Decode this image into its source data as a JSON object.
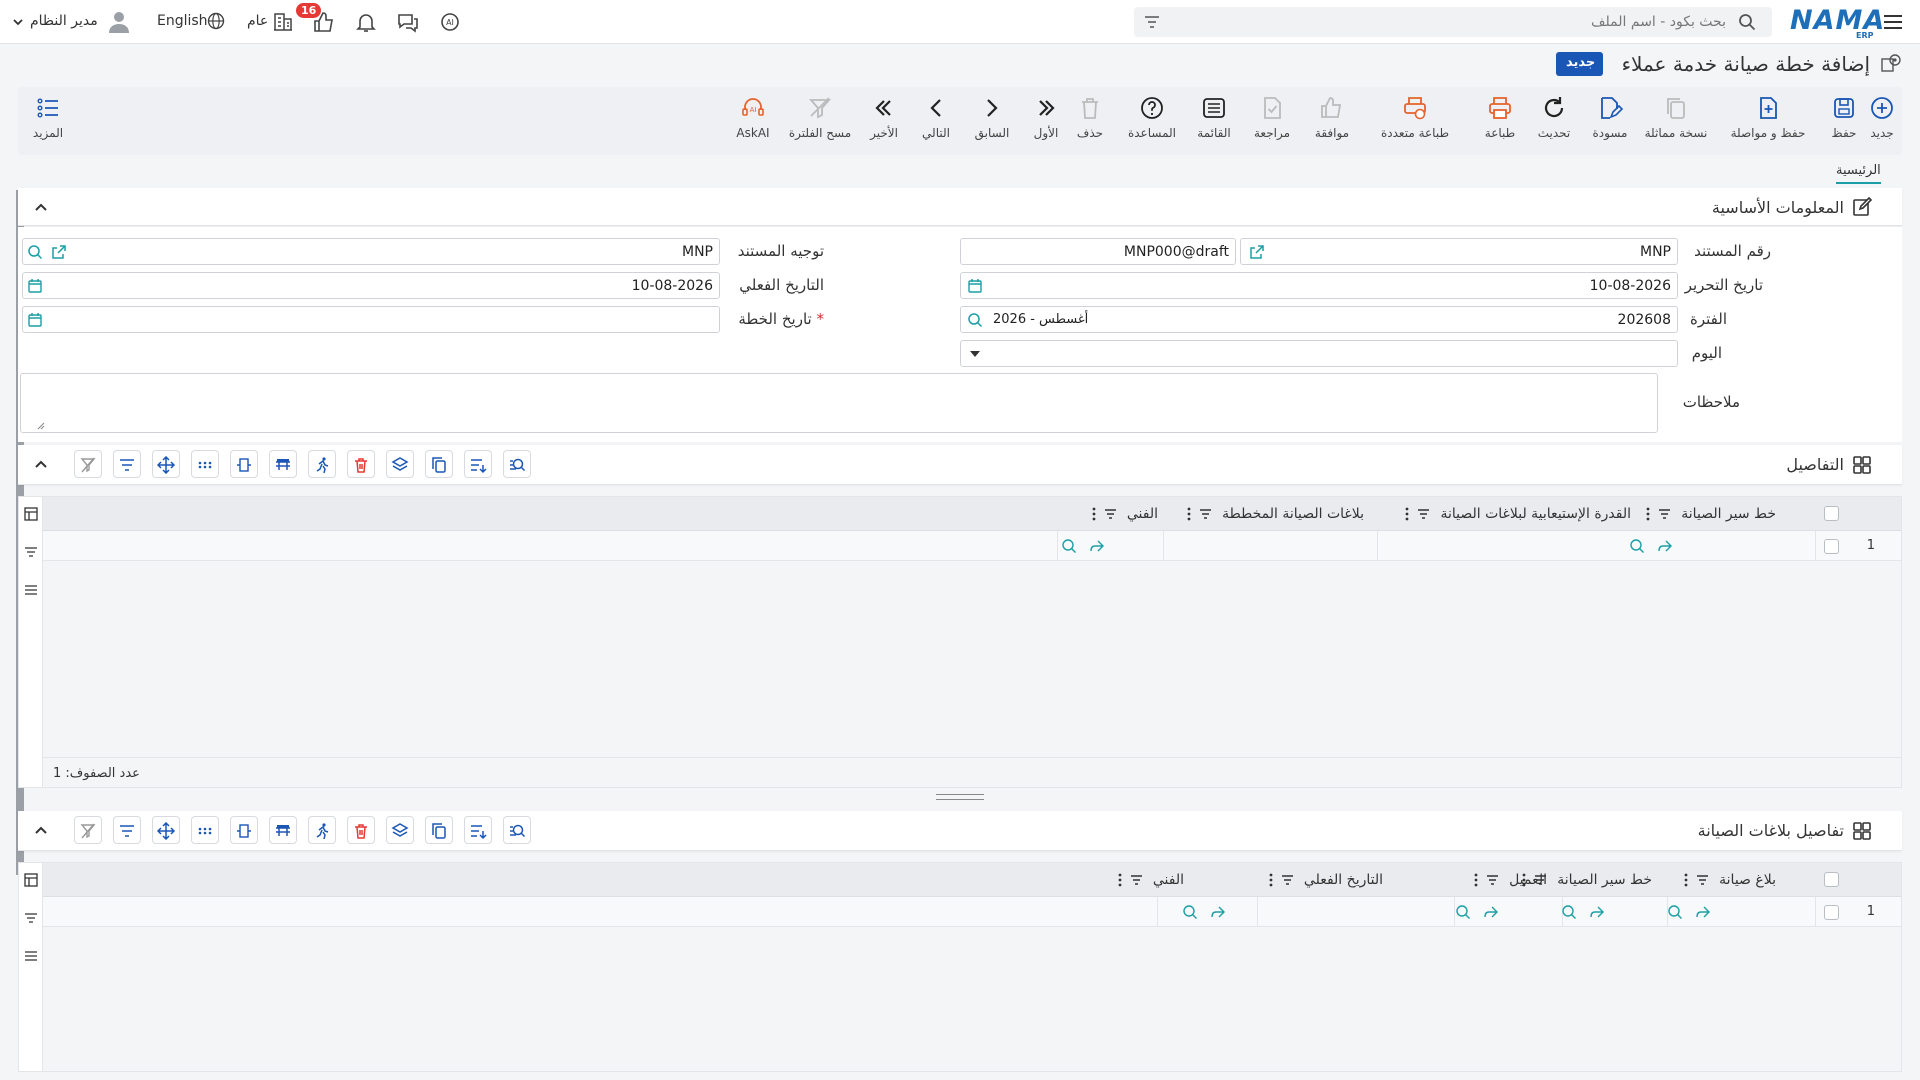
{
  "topbar": {
    "search_placeholder": "بحث بكود - اسم الملف",
    "logo": "NAMA",
    "logo_sub": "ERP",
    "user_name": "مدير النظام",
    "language": "English",
    "scope": "عام",
    "notifications_count": "16"
  },
  "page": {
    "title": "إضافة خطة صيانة خدمة عملاء",
    "new_tag": "جديد"
  },
  "toolbar": {
    "new": "جديد",
    "save": "حفظ",
    "save_continue": "حفظ و مواصلة",
    "duplicate": "نسخة مماثلة",
    "draft": "مسودة",
    "refresh": "تحديث",
    "print": "طباعة",
    "multi_print": "طباعة متعددة",
    "approve": "موافقة",
    "review": "مراجعة",
    "list": "القائمة",
    "help": "المساعدة",
    "delete": "حذف",
    "first": "الأول",
    "previous": "السابق",
    "next": "التالي",
    "last": "الأخير",
    "clear_filter": "مسح الفلترة",
    "askai": "AskAI",
    "more": "المزيد"
  },
  "tabs": {
    "main": "الرئيسية"
  },
  "basic_info": {
    "title": "المعلومات الأساسية",
    "doc_number_label": "رقم المستند",
    "doc_number_value": "MNP",
    "doc_code_value": "MNP000@draft",
    "doc_direction_label": "توجيه المستند",
    "doc_direction_value": "MNP",
    "edit_date_label": "تاريخ التحرير",
    "edit_date_value": "10-08-2026",
    "actual_date_label": "التاريخ الفعلي",
    "actual_date_value": "10-08-2026",
    "period_label": "الفترة",
    "period_value": "202608",
    "period_name": "2026 - أغسطس",
    "plan_date_label": "تاريخ الخطة",
    "plan_date_required": "*",
    "day_label": "اليوم",
    "notes_label": "ملاحظات"
  },
  "details": {
    "title": "التفاصيل",
    "columns": [
      "خط سير الصيانة",
      "القدرة الإستيعابية لبلاغات الصيانة",
      "بلاغات الصيانة المخططة",
      "الفني"
    ],
    "rows": [
      "1"
    ],
    "row_count": "عدد الصفوف: 1"
  },
  "requests": {
    "title": "تفاصيل بلاغات الصيانة",
    "columns": [
      "بلاغ صيانة",
      "خط سير الصيانة",
      "العميل",
      "التاريخ الفعلي",
      "الفني"
    ],
    "rows": [
      "1"
    ]
  },
  "colors": {
    "accent": "#1a9fa6",
    "primary": "#1a56b5",
    "orange": "#e8622c",
    "danger": "#e53935"
  }
}
